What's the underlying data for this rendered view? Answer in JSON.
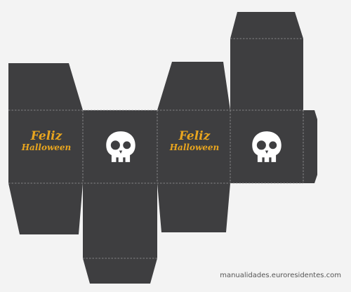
{
  "template": {
    "greeting": {
      "line1": "Feliz",
      "line2": "Halloween"
    },
    "watermark": "manualidades.euroresidentes.com",
    "colors": {
      "panel": "#3e3e40",
      "greeting": "#e8a51f",
      "skull": "#ffffff",
      "background": "#f3f3f3"
    },
    "icons": [
      "skull-icon"
    ]
  }
}
